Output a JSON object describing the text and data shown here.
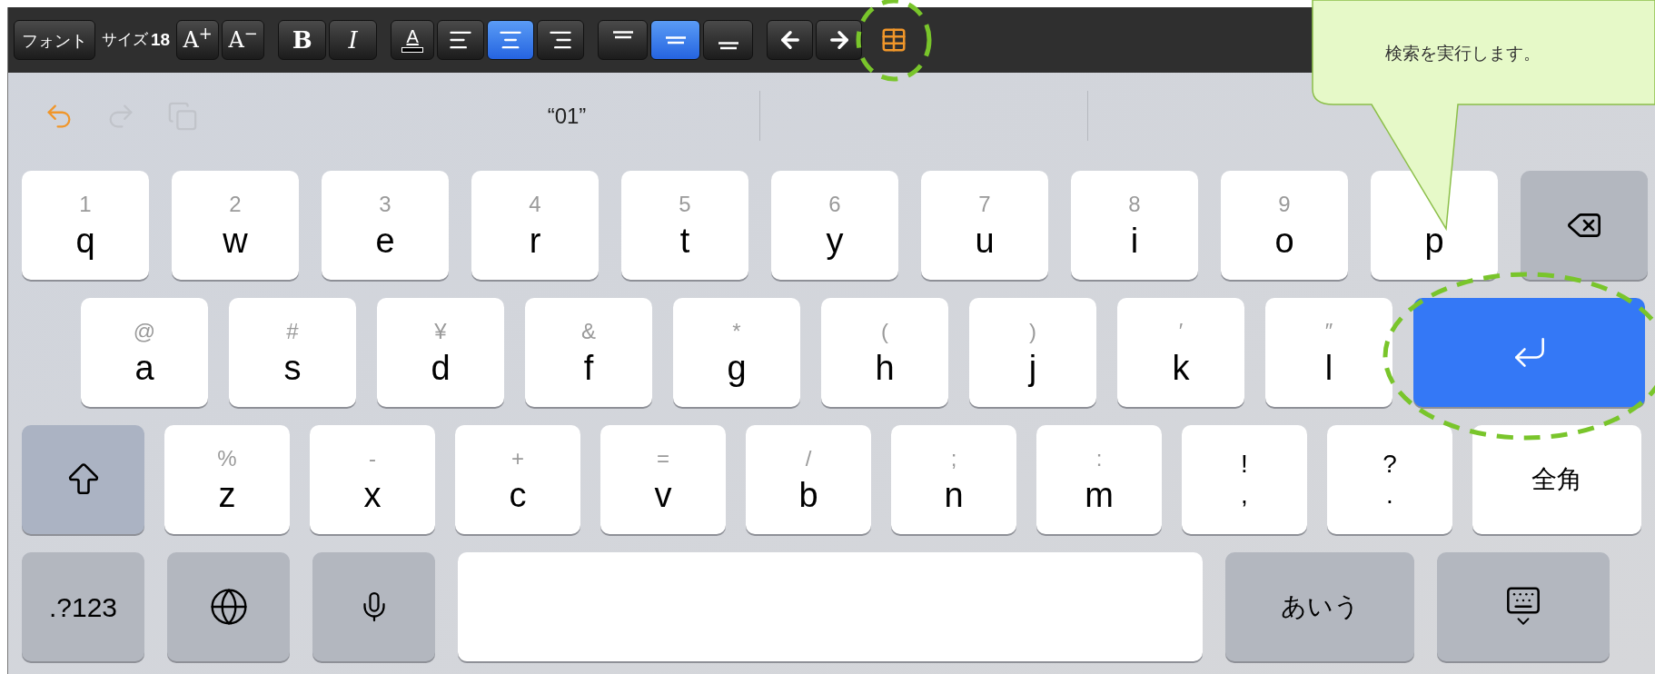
{
  "toolbar": {
    "font_button": "フォント",
    "size_label": "サイズ",
    "size_value": "18",
    "items": [
      {
        "kind": "text",
        "label": "A$^{+}$"
      },
      {
        "kind": "text",
        "label": "A$^{−}$"
      },
      {
        "kind": "bold",
        "label": "B"
      },
      {
        "kind": "italic",
        "label": "I"
      },
      {
        "kind": "color",
        "label": "A"
      },
      {
        "kind": "align-left",
        "selected": false
      },
      {
        "kind": "align-center",
        "selected": true
      },
      {
        "kind": "align-right",
        "selected": false
      },
      {
        "kind": "valign-top",
        "selected": false
      },
      {
        "kind": "valign-middle",
        "selected": true
      },
      {
        "kind": "valign-bottom",
        "selected": false
      },
      {
        "kind": "arrow-left"
      },
      {
        "kind": "arrow-right"
      },
      {
        "kind": "table",
        "highlighted": true
      }
    ]
  },
  "suggestion_bar": {
    "actions": [
      {
        "kind": "undo",
        "disabled": false
      },
      {
        "kind": "redo",
        "disabled": true
      },
      {
        "kind": "paste",
        "disabled": true
      }
    ],
    "candidates": [
      "“01”"
    ]
  },
  "callout": {
    "text": "検索を実行します。"
  },
  "keyboard": {
    "rows": [
      {
        "keys": [
          {
            "kind": "letter",
            "hint": "1",
            "label": "q"
          },
          {
            "kind": "letter",
            "hint": "2",
            "label": "w"
          },
          {
            "kind": "letter",
            "hint": "3",
            "label": "e"
          },
          {
            "kind": "letter",
            "hint": "4",
            "label": "r"
          },
          {
            "kind": "letter",
            "hint": "5",
            "label": "t"
          },
          {
            "kind": "letter",
            "hint": "6",
            "label": "y"
          },
          {
            "kind": "letter",
            "hint": "7",
            "label": "u"
          },
          {
            "kind": "letter",
            "hint": "8",
            "label": "i"
          },
          {
            "kind": "letter",
            "hint": "9",
            "label": "o"
          },
          {
            "kind": "letter",
            "label": "p"
          },
          {
            "kind": "backspace"
          }
        ]
      },
      {
        "keys": [
          {
            "kind": "letter",
            "hint": "@",
            "label": "a"
          },
          {
            "kind": "letter",
            "hint": "#",
            "label": "s"
          },
          {
            "kind": "letter",
            "hint": "¥",
            "label": "d"
          },
          {
            "kind": "letter",
            "hint": "&",
            "label": "f"
          },
          {
            "kind": "letter",
            "hint": "*",
            "label": "g"
          },
          {
            "kind": "letter",
            "hint": "(",
            "label": "h"
          },
          {
            "kind": "letter",
            "hint": ")",
            "label": "j"
          },
          {
            "kind": "letter",
            "hint": "′",
            "label": "k"
          },
          {
            "kind": "letter",
            "hint": "″",
            "label": "l"
          },
          {
            "kind": "return",
            "highlighted": true
          }
        ]
      },
      {
        "keys": [
          {
            "kind": "shift"
          },
          {
            "kind": "letter",
            "hint": "%",
            "label": "z"
          },
          {
            "kind": "letter",
            "hint": "-",
            "label": "x"
          },
          {
            "kind": "letter",
            "hint": "+",
            "label": "c"
          },
          {
            "kind": "letter",
            "hint": "=",
            "label": "v"
          },
          {
            "kind": "letter",
            "hint": "/",
            "label": "b"
          },
          {
            "kind": "letter",
            "hint": ";",
            "label": "n"
          },
          {
            "kind": "letter",
            "hint": ":",
            "label": "m"
          },
          {
            "kind": "punct",
            "top": "!",
            "label": ","
          },
          {
            "kind": "punct",
            "top": "?",
            "label": "."
          },
          {
            "kind": "wide",
            "label": "全角"
          }
        ]
      },
      {
        "keys": [
          {
            "kind": "function",
            "label": ".?123"
          },
          {
            "kind": "globe"
          },
          {
            "kind": "mic"
          },
          {
            "kind": "space"
          },
          {
            "kind": "function-wide",
            "label": "あいう"
          },
          {
            "kind": "hide"
          }
        ]
      }
    ]
  }
}
